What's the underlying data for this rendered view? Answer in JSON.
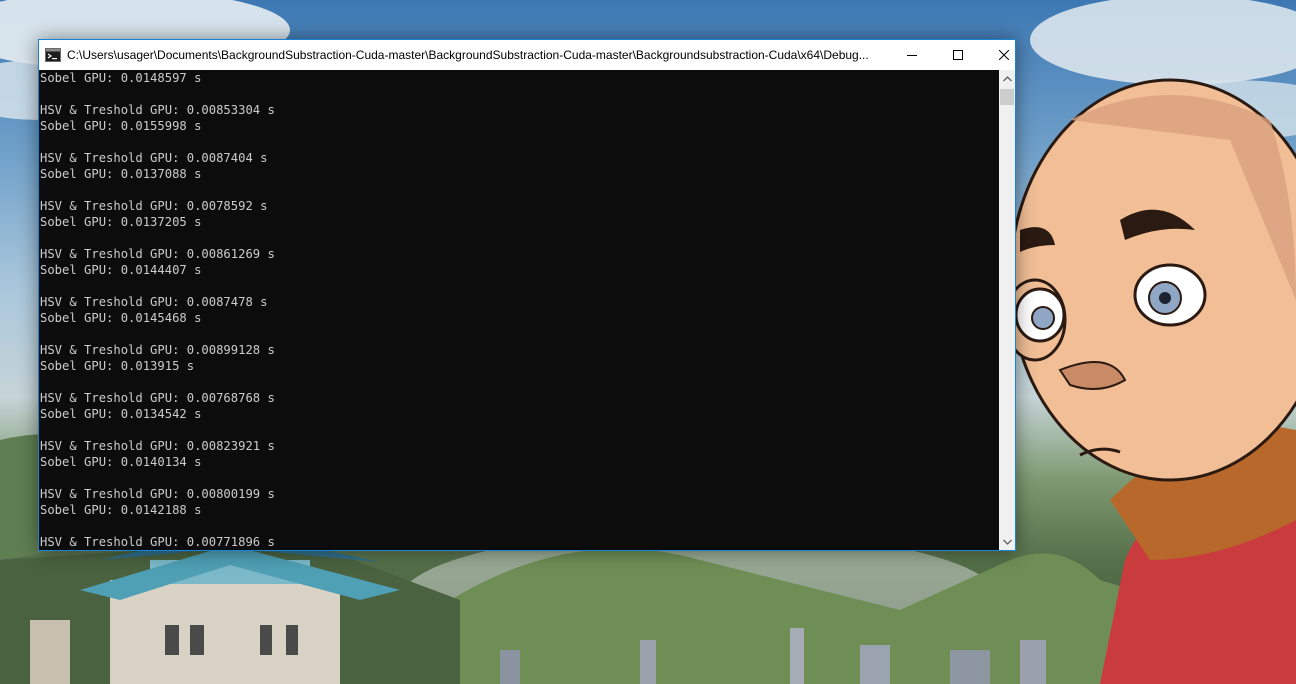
{
  "window": {
    "title": "C:\\Users\\usager\\Documents\\BackgroundSubstraction-Cuda-master\\BackgroundSubstraction-Cuda-master\\Backgroundsubstraction-Cuda\\x64\\Debug...",
    "minimize_icon": "minimize-icon",
    "maximize_icon": "maximize-icon",
    "close_icon": "close-icon"
  },
  "console": {
    "output": "Sobel GPU: 0.0148597 s\n\nHSV & Treshold GPU: 0.00853304 s\nSobel GPU: 0.0155998 s\n\nHSV & Treshold GPU: 0.0087404 s\nSobel GPU: 0.0137088 s\n\nHSV & Treshold GPU: 0.0078592 s\nSobel GPU: 0.0137205 s\n\nHSV & Treshold GPU: 0.00861269 s\nSobel GPU: 0.0144407 s\n\nHSV & Treshold GPU: 0.0087478 s\nSobel GPU: 0.0145468 s\n\nHSV & Treshold GPU: 0.00899128 s\nSobel GPU: 0.013915 s\n\nHSV & Treshold GPU: 0.00768768 s\nSobel GPU: 0.0134542 s\n\nHSV & Treshold GPU: 0.00823921 s\nSobel GPU: 0.0140134 s\n\nHSV & Treshold GPU: 0.00800199 s\nSobel GPU: 0.0142188 s\n\nHSV & Treshold GPU: 0.00771896 s",
    "text_color": "#cccccc",
    "background_color": "#0c0c0c"
  },
  "colors": {
    "window_border": "#1883d7",
    "title_bar": "#ffffff"
  }
}
